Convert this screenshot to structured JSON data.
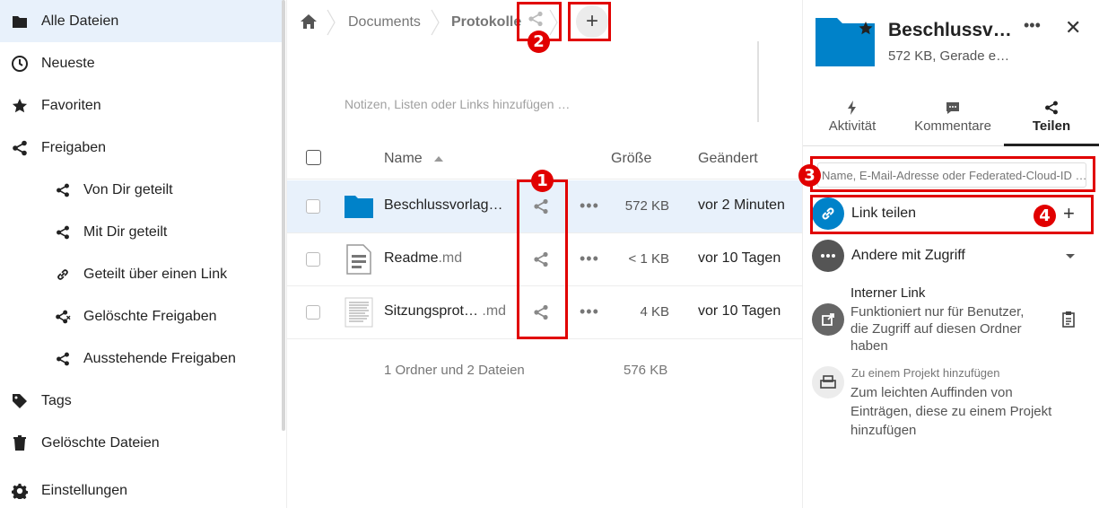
{
  "sidebar": {
    "items": [
      {
        "label": "Alle Dateien",
        "icon": "folder-icon"
      },
      {
        "label": "Neueste",
        "icon": "clock-icon"
      },
      {
        "label": "Favoriten",
        "icon": "star-icon"
      },
      {
        "label": "Freigaben",
        "icon": "share-icon"
      },
      {
        "label": "Von Dir geteilt",
        "icon": "share-icon"
      },
      {
        "label": "Mit Dir geteilt",
        "icon": "share-icon"
      },
      {
        "label": "Geteilt über einen Link",
        "icon": "link-icon"
      },
      {
        "label": "Gelöschte Freigaben",
        "icon": "share-deleted-icon"
      },
      {
        "label": "Ausstehende Freigaben",
        "icon": "share-icon"
      },
      {
        "label": "Tags",
        "icon": "tag-icon"
      },
      {
        "label": "Gelöschte Dateien",
        "icon": "trash-icon"
      },
      {
        "label": "Einstellungen",
        "icon": "gear-icon"
      }
    ]
  },
  "breadcrumb": {
    "items": [
      "Documents",
      "Protokolle"
    ]
  },
  "notes": {
    "placeholder": "Notizen, Listen oder Links hinzufügen …"
  },
  "table": {
    "columns": {
      "name": "Name",
      "size": "Größe",
      "modified": "Geändert"
    },
    "rows": [
      {
        "name": "Beschlussvorlag…",
        "ext": "",
        "size": "572 KB",
        "modified": "vor 2 Minuten",
        "type": "folder"
      },
      {
        "name": "Readme",
        "ext": ".md",
        "size": "< 1 KB",
        "modified": "vor 10 Tagen",
        "type": "text"
      },
      {
        "name": "Sitzungsprot…",
        "ext": " .md",
        "size": "4 KB",
        "modified": "vor 10 Tagen",
        "type": "document"
      }
    ],
    "summary": "1 Ordner und 2 Dateien",
    "summary_size": "576 KB"
  },
  "details": {
    "title": "Beschlussv…",
    "subtitle": "572 KB, Gerade e…",
    "more_label": "•••",
    "close_label": "✕",
    "tabs": [
      {
        "label": "Aktivität",
        "icon": "bolt-icon"
      },
      {
        "label": "Kommentare",
        "icon": "comment-icon"
      },
      {
        "label": "Teilen",
        "icon": "share-icon"
      }
    ],
    "share_input_placeholder": "Name, E-Mail-Adresse oder Federated-Cloud-ID …",
    "link_share_label": "Link teilen",
    "others_label": "Andere mit Zugriff",
    "internal_link_title": "Interner Link",
    "internal_link_desc": "Funktioniert nur für Benutzer, die Zugriff auf diesen Ordner haben",
    "project_title": "Zu einem Projekt hinzufügen",
    "project_desc": "Zum leichten Auffinden von Einträgen, diese zu einem Projekt hinzufügen"
  },
  "annotations": {
    "markers": [
      "1",
      "2",
      "3",
      "4"
    ]
  },
  "colors": {
    "accent": "#0082c9",
    "highlight": "#e10000",
    "selected_row": "#e8f1fb"
  }
}
